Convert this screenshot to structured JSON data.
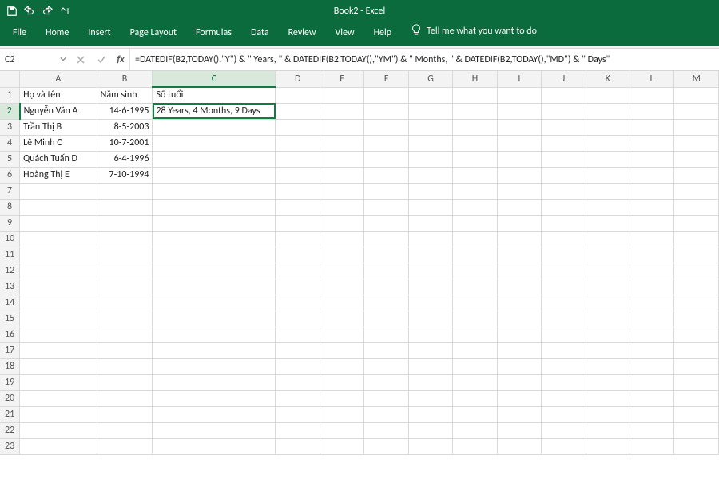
{
  "app": {
    "title": "Book2  -  Excel"
  },
  "qat": {
    "save": "save-icon",
    "undo": "undo-icon",
    "redo": "redo-icon",
    "customize": "customize-qat-icon"
  },
  "ribbon": {
    "tabs": [
      "File",
      "Home",
      "Insert",
      "Page Layout",
      "Formulas",
      "Data",
      "Review",
      "View",
      "Help"
    ],
    "tell_me": "Tell me what you want to do"
  },
  "namebox": {
    "value": "C2"
  },
  "formula_bar": {
    "cancel": "×",
    "enter": "✓",
    "fx": "fx",
    "value": "=DATEDIF(B2,TODAY(),\"Y\") & \" Years, \" & DATEDIF(B2,TODAY(),\"YM\") & \" Months, \" & DATEDIF(B2,TODAY(),\"MD\") & \" Days\""
  },
  "grid": {
    "columns": [
      "A",
      "B",
      "C",
      "D",
      "E",
      "F",
      "G",
      "H",
      "I",
      "J",
      "K",
      "L",
      "M"
    ],
    "row_count": 23,
    "active": {
      "col": "C",
      "row": 2
    },
    "headers_row": {
      "A": "Họ và tên",
      "B": "Năm sinh",
      "C": "Số tuổi"
    },
    "data": [
      {
        "A": "Nguyễn Văn A",
        "B": "14-6-1995",
        "C": "28 Years, 4 Months, 9 Days"
      },
      {
        "A": "Trần Thị B",
        "B": "8-5-2003",
        "C": ""
      },
      {
        "A": "Lê Minh C",
        "B": "10-7-2001",
        "C": ""
      },
      {
        "A": "Quách Tuấn D",
        "B": "6-4-1996",
        "C": ""
      },
      {
        "A": "Hoàng Thị E",
        "B": "7-10-1994",
        "C": ""
      }
    ]
  }
}
